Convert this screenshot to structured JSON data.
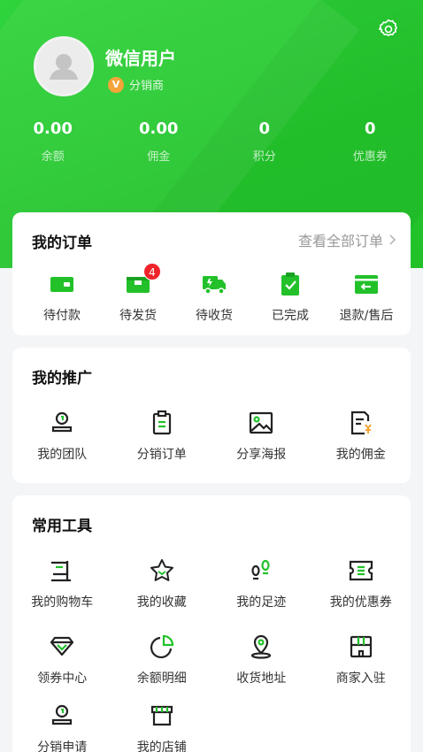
{
  "profile": {
    "username": "微信用户",
    "role_badge": "V",
    "role": "分销商"
  },
  "stats": [
    {
      "value": "0.00",
      "label": "余额"
    },
    {
      "value": "0.00",
      "label": "佣金"
    },
    {
      "value": "0",
      "label": "积分"
    },
    {
      "value": "0",
      "label": "优惠券"
    }
  ],
  "orders": {
    "title": "我的订单",
    "view_all": "查看全部订单",
    "items": [
      {
        "label": "待付款",
        "icon": "wallet-icon"
      },
      {
        "label": "待发货",
        "icon": "package-icon",
        "badge": "4"
      },
      {
        "label": "待收货",
        "icon": "truck-icon"
      },
      {
        "label": "已完成",
        "icon": "clipboard-check-icon"
      },
      {
        "label": "退款/售后",
        "icon": "refund-icon"
      }
    ]
  },
  "promotion": {
    "title": "我的推广",
    "items": [
      {
        "label": "我的团队",
        "icon": "team-icon"
      },
      {
        "label": "分销订单",
        "icon": "clipboard-icon"
      },
      {
        "label": "分享海报",
        "icon": "image-icon"
      },
      {
        "label": "我的佣金",
        "icon": "commission-icon"
      }
    ]
  },
  "tools": {
    "title": "常用工具",
    "items": [
      {
        "label": "我的购物车",
        "icon": "cart-icon"
      },
      {
        "label": "我的收藏",
        "icon": "star-icon"
      },
      {
        "label": "我的足迹",
        "icon": "footprint-icon"
      },
      {
        "label": "我的优惠券",
        "icon": "coupon-icon"
      },
      {
        "label": "领券中心",
        "icon": "diamond-icon"
      },
      {
        "label": "余额明细",
        "icon": "pie-chart-icon"
      },
      {
        "label": "收货地址",
        "icon": "location-icon"
      },
      {
        "label": "商家入驻",
        "icon": "shop-join-icon"
      },
      {
        "label": "分销申请",
        "icon": "apply-icon"
      },
      {
        "label": "我的店铺",
        "icon": "store-icon"
      }
    ]
  },
  "colors": {
    "accent": "#22c12a",
    "badge": "#f0232b",
    "role_badge": "#f3a53a"
  }
}
